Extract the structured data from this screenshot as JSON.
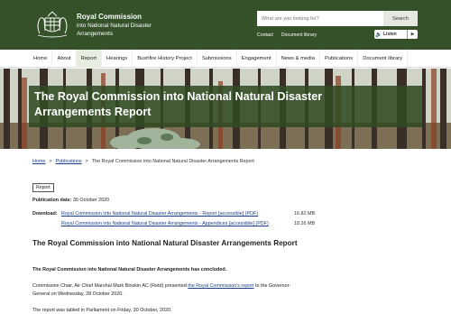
{
  "header": {
    "brand_title": "Royal Commission",
    "brand_line2": "into National Natural Disaster",
    "brand_line3": "Arrangements",
    "search_placeholder": "What are you looking for?",
    "search_button": "Search",
    "contact_link": "Contact",
    "document_library_link": "Document library",
    "listen_label": "Listen",
    "colors": {
      "header_bg": "#34512a",
      "title_bar": "#304a22",
      "link": "#1b3e8a"
    }
  },
  "nav": {
    "items": [
      "Home",
      "About",
      "Report",
      "Hearings",
      "Bushfire History Project",
      "Submissions",
      "Engagement",
      "News & media",
      "Publications",
      "Document library"
    ],
    "active": "Report"
  },
  "hero": {
    "title_line1": "The Royal Commission into National Natural Disaster",
    "title_line2": "Arrangements Report"
  },
  "breadcrumb": {
    "home": "Home",
    "publications": "Publications",
    "current": "The Royal Commission into National Natural Disaster Arrangements Report",
    "separator": ">"
  },
  "content": {
    "tag": "Report",
    "pubdate_label": "Publication date:",
    "pubdate_value": "30 October 2020",
    "download_label": "Download:",
    "downloads": [
      {
        "label": "Royal Commission into National Natural Disaster Arrangements - Report [accessible] (PDF)",
        "size": "16.82 MB"
      },
      {
        "label": "Royal Commission into National Natural Disaster Arrangements - Appendices [accessible] (PDF)",
        "size": "18.26 MB"
      }
    ],
    "heading": "The Royal Commission into National Natural Disaster Arrangements Report",
    "para1": "The Royal Commission into National Natural Disaster Arrangements has concluded.",
    "para2_before": "Commission Chair, Air Chief Marshal Mark Binskin AC (Retd) presented ",
    "para2_link": "the Royal Commission's report",
    "para2_after": " to the Governor-General on Wednesday, 28 October 2020.",
    "para3": "The report was tabled in Parliament on Friday, 30 October, 2020."
  }
}
